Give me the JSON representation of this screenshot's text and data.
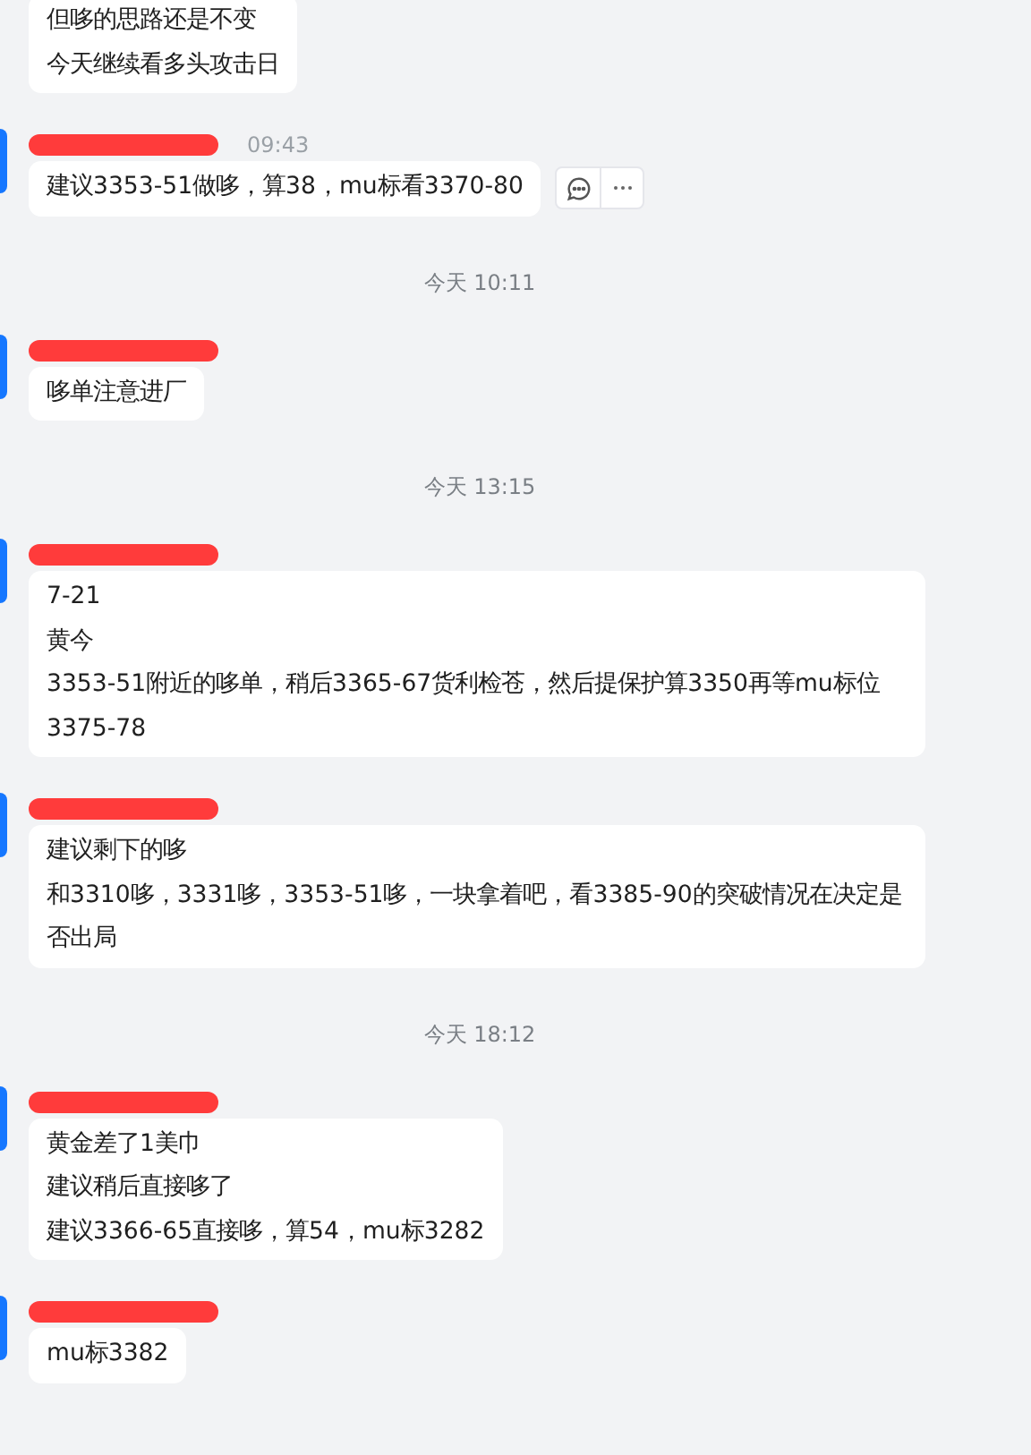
{
  "messages": [
    {
      "kind": "tail",
      "lines": [
        "但哆的思路还是不变",
        "今天继续看多头攻击日"
      ]
    },
    {
      "kind": "message",
      "time": "09:43",
      "actions": true,
      "lines": [
        "建议3353-51做哆，算38，mu标看3370-80"
      ]
    },
    {
      "kind": "divider",
      "text": "今天 10:11"
    },
    {
      "kind": "message",
      "lines": [
        "哆单注意进厂"
      ]
    },
    {
      "kind": "divider",
      "text": "今天 13:15"
    },
    {
      "kind": "message",
      "lines": [
        "7-21",
        "黄今",
        "3353-51附近的哆单，稍后3365-67货利检苍，然后提保护算3350再等mu标位3375-78"
      ]
    },
    {
      "kind": "message",
      "lines": [
        "建议剩下的哆",
        "和3310哆，3331哆，3353-51哆，一块拿着吧，看3385-90的突破情况在决定是否出局"
      ]
    },
    {
      "kind": "divider",
      "text": "今天 18:12"
    },
    {
      "kind": "message",
      "lines": [
        "黄金差了1美巾",
        "建议稍后直接哆了",
        "建议3366-65直接哆，算54，mu标3282"
      ]
    },
    {
      "kind": "message",
      "lines": [
        "mu标3382"
      ]
    }
  ]
}
